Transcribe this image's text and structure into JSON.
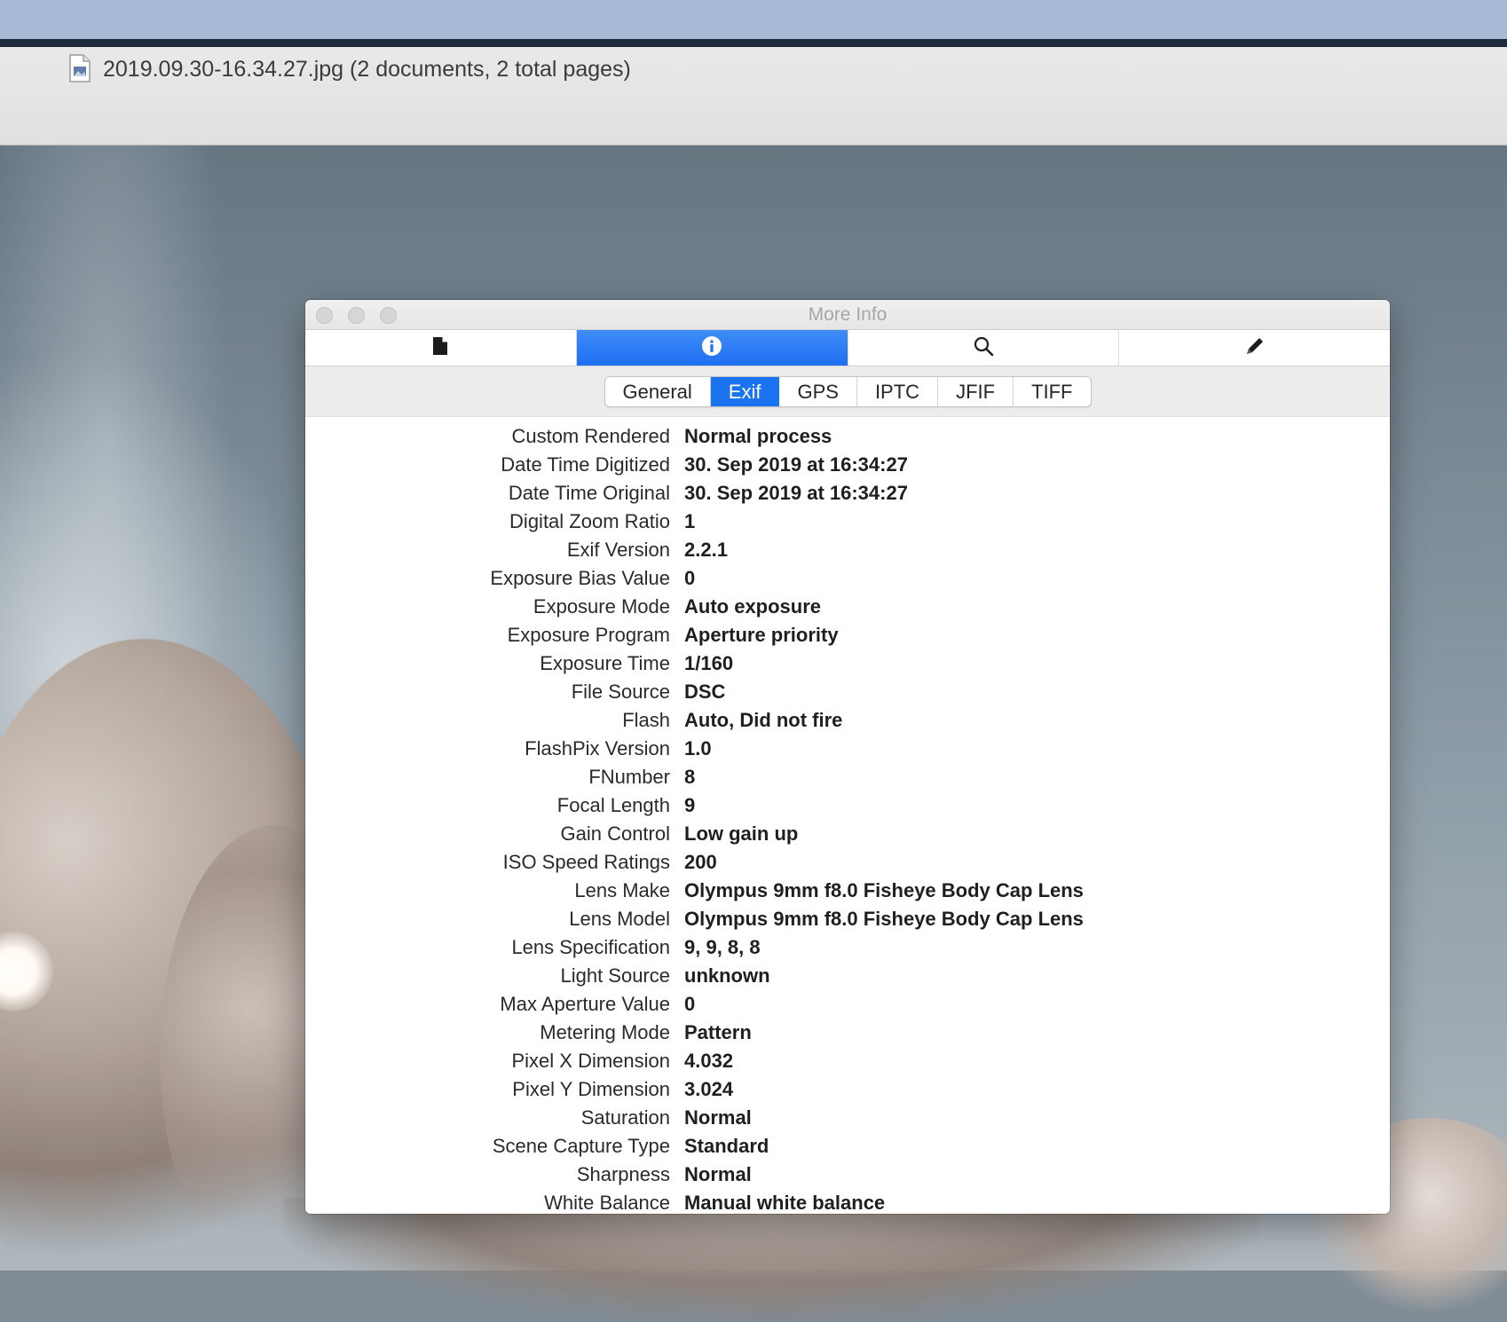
{
  "document": {
    "title": "2019.09.30-16.34.27.jpg (2 documents, 2 total pages)",
    "icon": "jpeg-document-icon"
  },
  "window": {
    "title": "More Info",
    "toolbar_tabs": [
      {
        "icon": "document-icon",
        "active": false
      },
      {
        "icon": "info-icon",
        "active": true
      },
      {
        "icon": "magnifier-icon",
        "active": false
      },
      {
        "icon": "pencil-icon",
        "active": false
      }
    ],
    "accent_color": "#1a73ef"
  },
  "tabs": [
    {
      "label": "General",
      "active": false
    },
    {
      "label": "Exif",
      "active": true
    },
    {
      "label": "GPS",
      "active": false
    },
    {
      "label": "IPTC",
      "active": false
    },
    {
      "label": "JFIF",
      "active": false
    },
    {
      "label": "TIFF",
      "active": false
    }
  ],
  "exif": [
    {
      "key": "Custom Rendered",
      "value": "Normal process"
    },
    {
      "key": "Date Time Digitized",
      "value": "30. Sep 2019 at 16:34:27"
    },
    {
      "key": "Date Time Original",
      "value": "30. Sep 2019 at 16:34:27"
    },
    {
      "key": "Digital Zoom Ratio",
      "value": "1"
    },
    {
      "key": "Exif Version",
      "value": "2.2.1"
    },
    {
      "key": "Exposure Bias Value",
      "value": "0"
    },
    {
      "key": "Exposure Mode",
      "value": "Auto exposure"
    },
    {
      "key": "Exposure Program",
      "value": "Aperture priority"
    },
    {
      "key": "Exposure Time",
      "value": "1/160"
    },
    {
      "key": "File Source",
      "value": "DSC"
    },
    {
      "key": "Flash",
      "value": "Auto, Did not fire"
    },
    {
      "key": "FlashPix Version",
      "value": "1.0"
    },
    {
      "key": "FNumber",
      "value": "8"
    },
    {
      "key": "Focal Length",
      "value": "9"
    },
    {
      "key": "Gain Control",
      "value": "Low gain up"
    },
    {
      "key": "ISO Speed Ratings",
      "value": "200"
    },
    {
      "key": "Lens Make",
      "value": "Olympus 9mm f8.0 Fisheye Body Cap Lens"
    },
    {
      "key": "Lens Model",
      "value": "Olympus 9mm f8.0 Fisheye Body Cap Lens"
    },
    {
      "key": "Lens Specification",
      "value": "9, 9, 8, 8"
    },
    {
      "key": "Light Source",
      "value": "unknown"
    },
    {
      "key": "Max Aperture Value",
      "value": "0"
    },
    {
      "key": "Metering Mode",
      "value": "Pattern"
    },
    {
      "key": "Pixel X Dimension",
      "value": "4.032"
    },
    {
      "key": "Pixel Y Dimension",
      "value": "3.024"
    },
    {
      "key": "Saturation",
      "value": "Normal"
    },
    {
      "key": "Scene Capture Type",
      "value": "Standard"
    },
    {
      "key": "Sharpness",
      "value": "Normal"
    },
    {
      "key": "White Balance",
      "value": "Manual white balance"
    }
  ]
}
